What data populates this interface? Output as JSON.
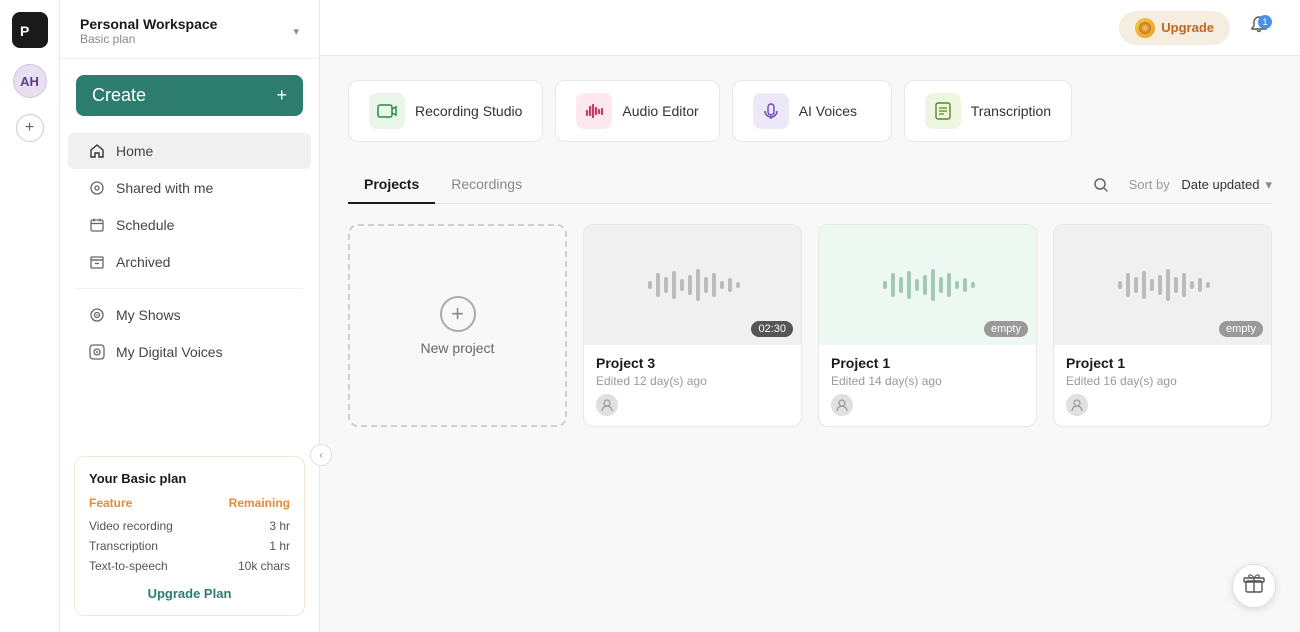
{
  "app": {
    "logo_text": "P",
    "logo_alt": "Podcastle"
  },
  "user": {
    "initials": "AH"
  },
  "workspace": {
    "name": "Personal Workspace",
    "plan": "Basic plan",
    "chevron": "▾"
  },
  "create_button": {
    "label": "Create",
    "icon": "+"
  },
  "nav": {
    "items": [
      {
        "id": "home",
        "label": "Home",
        "icon": "⌂",
        "active": true
      },
      {
        "id": "shared",
        "label": "Shared with me",
        "icon": "⊙"
      },
      {
        "id": "schedule",
        "label": "Schedule",
        "icon": "📅"
      },
      {
        "id": "archived",
        "label": "Archived",
        "icon": "🗑"
      },
      {
        "id": "shows",
        "label": "My Shows",
        "icon": "◎"
      },
      {
        "id": "voices",
        "label": "My Digital Voices",
        "icon": "◈"
      }
    ],
    "collapse_icon": "‹"
  },
  "basic_plan": {
    "title": "Your Basic plan",
    "col1": "Feature",
    "col2": "Remaining",
    "rows": [
      {
        "feature": "Video recording",
        "value": "3 hr"
      },
      {
        "feature": "Transcription",
        "value": "1 hr"
      },
      {
        "feature": "Text-to-speech",
        "value": "10k chars"
      }
    ],
    "upgrade_link": "Upgrade Plan"
  },
  "topbar": {
    "upgrade_label": "Upgrade",
    "notif_count": "1"
  },
  "tiles": [
    {
      "id": "recording-studio",
      "label": "Recording Studio",
      "icon": "🎥",
      "color": "green"
    },
    {
      "id": "audio-editor",
      "label": "Audio Editor",
      "icon": "🎚",
      "color": "pink"
    },
    {
      "id": "ai-voices",
      "label": "AI Voices",
      "icon": "🎙",
      "color": "purple"
    },
    {
      "id": "transcription",
      "label": "Transcription",
      "icon": "📝",
      "color": "lime"
    }
  ],
  "tabs": {
    "items": [
      {
        "id": "projects",
        "label": "Projects",
        "active": true
      },
      {
        "id": "recordings",
        "label": "Recordings",
        "active": false
      }
    ],
    "sort_label": "Sort by",
    "sort_value": "Date updated"
  },
  "projects": {
    "new_project_label": "New project",
    "new_project_icon": "+",
    "cards": [
      {
        "id": "project3",
        "title": "Project 3",
        "date": "Edited 12 day(s) ago",
        "badge": "02:30",
        "badge_type": "time",
        "bg": "gray"
      },
      {
        "id": "project1a",
        "title": "Project 1",
        "date": "Edited 14 day(s) ago",
        "badge": "empty",
        "badge_type": "empty",
        "bg": "light-green"
      },
      {
        "id": "project1b",
        "title": "Project 1",
        "date": "Edited 16 day(s) ago",
        "badge": "empty",
        "badge_type": "empty",
        "bg": "gray"
      }
    ]
  },
  "icons": {
    "home": "⌂",
    "search": "🔍",
    "bell": "🔔",
    "gift": "🎁",
    "collapse": "‹",
    "add": "+",
    "chevron_down": "▾",
    "user_circle": "👤"
  }
}
